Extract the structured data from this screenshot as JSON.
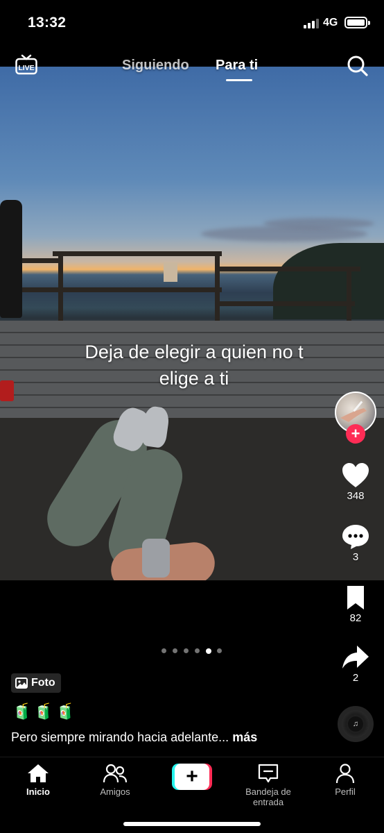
{
  "status_bar": {
    "time": "13:32",
    "network": "4G",
    "battery_icon": "battery-full-icon",
    "signal_icon": "cellular-signal-icon"
  },
  "top_nav": {
    "live_icon": "live-tv-icon",
    "live_label": "LIVE",
    "tabs": [
      {
        "label": "Siguiendo",
        "active": false
      },
      {
        "label": "Para ti",
        "active": true
      }
    ],
    "search_icon": "search-icon"
  },
  "post": {
    "overlay_text_line1": "Deja de elegir a quien no t",
    "overlay_text_line2": "elige a ti",
    "badge_label": "Foto",
    "badge_icon": "photo-icon",
    "emojis": "🧃🧃🧃",
    "caption": "Pero siempre mirando hacia adelante...",
    "more_label": "más",
    "photo_count": 6,
    "current_photo_index": 5
  },
  "actions": {
    "likes": "348",
    "comments": "3",
    "saves": "82",
    "shares": "2",
    "follow_icon": "plus-icon"
  },
  "bottom_nav": {
    "items": [
      {
        "label": "Inicio",
        "icon": "home-icon",
        "active": true
      },
      {
        "label": "Amigos",
        "icon": "friends-icon",
        "active": false
      },
      {
        "label": "",
        "icon": "create-plus-icon",
        "active": false
      },
      {
        "label": "Bandeja de entrada",
        "icon": "inbox-icon",
        "active": false
      },
      {
        "label": "Perfil",
        "icon": "profile-icon",
        "active": false
      }
    ]
  },
  "colors": {
    "accent_red": "#fe2c55",
    "accent_cyan": "#25f4ee",
    "background": "#000000"
  }
}
